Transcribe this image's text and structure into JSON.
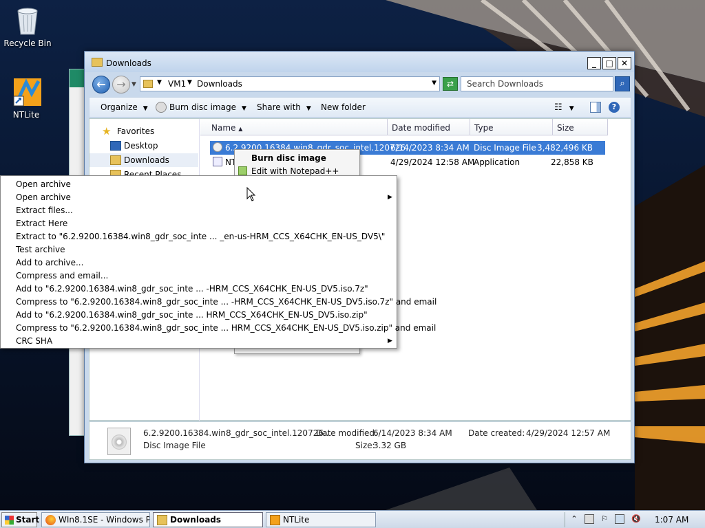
{
  "desktop": {
    "icons": [
      {
        "label": "Recycle Bin"
      },
      {
        "label": "NTLite"
      }
    ]
  },
  "window": {
    "title": "Downloads",
    "buttons": {
      "minimize": "_",
      "maximize": "□",
      "close": "✕"
    }
  },
  "address": {
    "segments": [
      "VM1",
      "Downloads"
    ],
    "search_placeholder": "Search Downloads"
  },
  "toolbar": {
    "organize": "Organize",
    "burn": "Burn disc image",
    "share": "Share with",
    "newfolder": "New folder"
  },
  "nav": {
    "items": [
      {
        "label": "Favorites"
      },
      {
        "label": "Desktop"
      },
      {
        "label": "Downloads"
      },
      {
        "label": "Recent Places"
      }
    ]
  },
  "columns": {
    "name": "Name",
    "date": "Date modified",
    "type": "Type",
    "size": "Size"
  },
  "files": [
    {
      "name": "6.2.9200.16384.win8_gdr_soc_intel.120726...",
      "date": "6/14/2023 8:34 AM",
      "type": "Disc Image File",
      "size": "3,482,496 KB"
    },
    {
      "name": "NT",
      "date": "4/29/2024 12:58 AM",
      "type": "Application",
      "size": "22,858 KB"
    }
  ],
  "context_menu": {
    "items": [
      "Burn disc image",
      "Edit with Notepad++"
    ]
  },
  "zip_menu": {
    "items": [
      {
        "label": "Open archive",
        "submenu": false
      },
      {
        "label": "Open archive",
        "submenu": true
      },
      {
        "label": "Extract files...",
        "submenu": false
      },
      {
        "label": "Extract Here",
        "submenu": false
      },
      {
        "label": "Extract to \"6.2.9200.16384.win8_gdr_soc_inte ... _en-us-HRM_CCS_X64CHK_EN-US_DV5\\\"",
        "submenu": false
      },
      {
        "label": "Test archive",
        "submenu": false
      },
      {
        "label": "Add to archive...",
        "submenu": false
      },
      {
        "label": "Compress and email...",
        "submenu": false
      },
      {
        "label": "Add to \"6.2.9200.16384.win8_gdr_soc_inte ... -HRM_CCS_X64CHK_EN-US_DV5.iso.7z\"",
        "submenu": false
      },
      {
        "label": "Compress to \"6.2.9200.16384.win8_gdr_soc_inte ... -HRM_CCS_X64CHK_EN-US_DV5.iso.7z\" and email",
        "submenu": false
      },
      {
        "label": "Add to \"6.2.9200.16384.win8_gdr_soc_inte ... HRM_CCS_X64CHK_EN-US_DV5.iso.zip\"",
        "submenu": false
      },
      {
        "label": "Compress to \"6.2.9200.16384.win8_gdr_soc_inte ... HRM_CCS_X64CHK_EN-US_DV5.iso.zip\" and email",
        "submenu": false
      },
      {
        "label": "CRC SHA",
        "submenu": true
      }
    ]
  },
  "details": {
    "name": "6.2.9200.16384.win8_gdr_soc_intel.120726...",
    "type": "Disc Image File",
    "date_modified_label": "Date modified:",
    "date_modified": "6/14/2023 8:34 AM",
    "size_label": "Size:",
    "size": "3.32 GB",
    "date_created_label": "Date created:",
    "date_created": "4/29/2024 12:57 AM"
  },
  "taskbar": {
    "start": "Start",
    "tasks": [
      {
        "label": "WIn8.1SE - Windows P..."
      },
      {
        "label": "Downloads"
      },
      {
        "label": "NTLite"
      }
    ],
    "clock": "1:07 AM"
  }
}
